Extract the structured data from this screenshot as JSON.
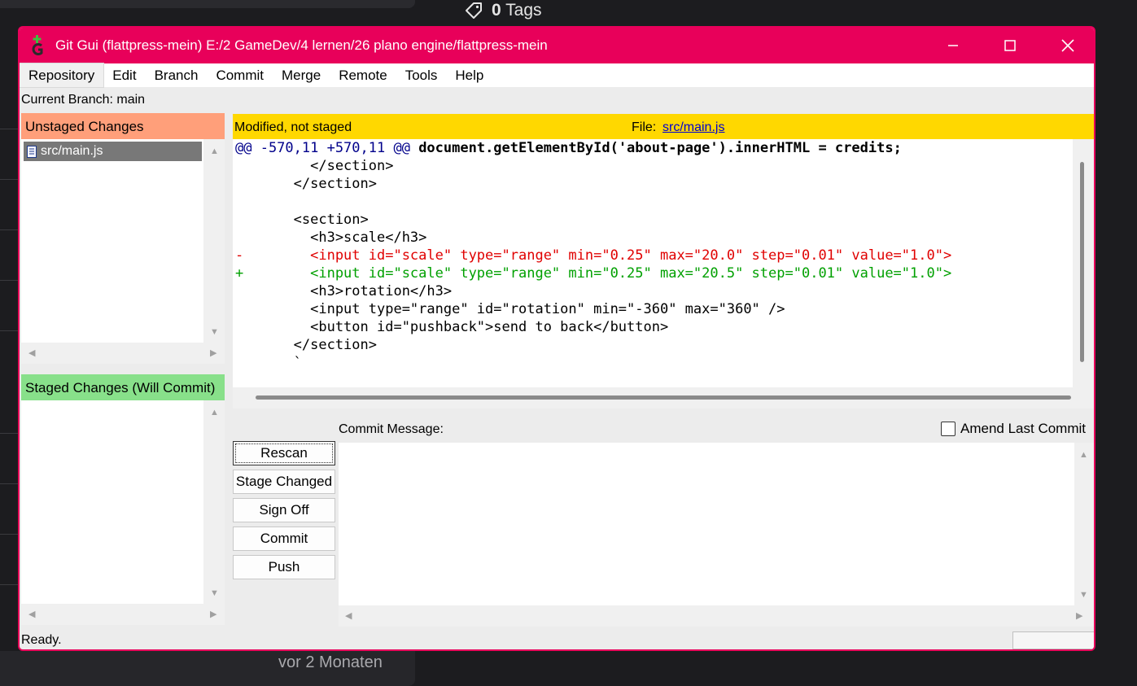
{
  "background": {
    "tags_count": "0",
    "tags_label": "Tags",
    "time_ago": "vor 2 Monaten"
  },
  "window": {
    "title": "Git Gui (flattpress-mein) E:/2 GameDev/4 lernen/26 plano engine/flattpress-mein",
    "accent_color": "#e8005a"
  },
  "menu": [
    "Repository",
    "Edit",
    "Branch",
    "Commit",
    "Merge",
    "Remote",
    "Tools",
    "Help"
  ],
  "current_branch": "Current Branch: main",
  "unstaged": {
    "header": "Unstaged Changes",
    "files": [
      "src/main.js"
    ]
  },
  "staged": {
    "header": "Staged Changes (Will Commit)"
  },
  "diff": {
    "status": "Modified, not staged",
    "file_label": "File:",
    "file_name": "src/main.js",
    "hunk_header": "@@ -570,11 +570,11 @@",
    "hunk_context": "document.getElementById('about-page').innerHTML = credits;",
    "lines": [
      {
        "type": "ctx",
        "text": "         </section>"
      },
      {
        "type": "ctx",
        "text": "       </section>"
      },
      {
        "type": "ctx",
        "text": ""
      },
      {
        "type": "ctx",
        "text": "       <section>"
      },
      {
        "type": "ctx",
        "text": "         <h3>scale</h3>"
      },
      {
        "type": "del",
        "text": "-        <input id=\"scale\" type=\"range\" min=\"0.25\" max=\"20.0\" step=\"0.01\" value=\"1.0\">"
      },
      {
        "type": "add",
        "text": "+        <input id=\"scale\" type=\"range\" min=\"0.25\" max=\"20.5\" step=\"0.01\" value=\"1.0\">"
      },
      {
        "type": "ctx",
        "text": "         <h3>rotation</h3>"
      },
      {
        "type": "ctx",
        "text": "         <input type=\"range\" id=\"rotation\" min=\"-360\" max=\"360\" />"
      },
      {
        "type": "ctx",
        "text": "         <button id=\"pushback\">send to back</button>"
      },
      {
        "type": "ctx",
        "text": "       </section>"
      },
      {
        "type": "ctx",
        "text": "       `"
      }
    ]
  },
  "commit": {
    "message_label": "Commit Message:",
    "amend_label": "Amend Last Commit",
    "buttons": {
      "rescan": "Rescan",
      "stage_changed": "Stage Changed",
      "sign_off": "Sign Off",
      "commit": "Commit",
      "push": "Push"
    }
  },
  "status": "Ready."
}
